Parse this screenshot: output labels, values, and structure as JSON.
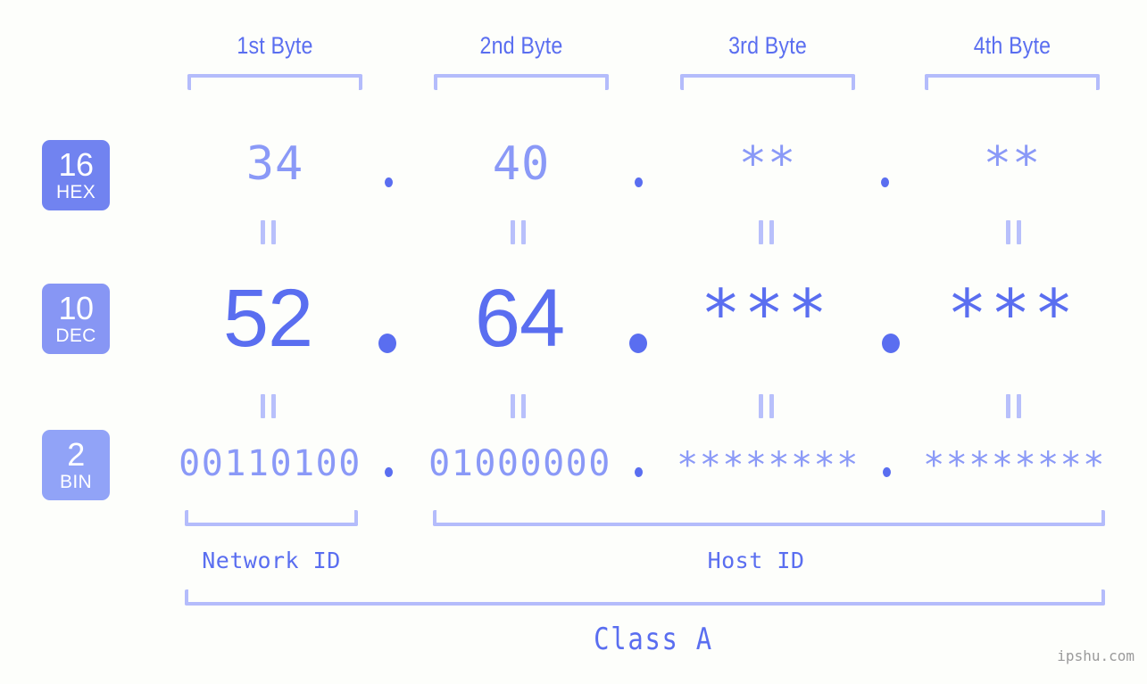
{
  "meta": {
    "background_color": "#fdfefb",
    "accent_strong": "#5a6ef0",
    "accent_light": "#8a99f7",
    "accent_pale": "#b4bcfb",
    "watermark": "ipshu.com"
  },
  "byte_headers": [
    {
      "label": "1st Byte"
    },
    {
      "label": "2nd Byte"
    },
    {
      "label": "3rd Byte"
    },
    {
      "label": "4th Byte"
    }
  ],
  "bases": [
    {
      "num": "16",
      "name": "HEX",
      "color": "#7183f0"
    },
    {
      "num": "10",
      "name": "DEC",
      "color": "#8796f4"
    },
    {
      "num": "2",
      "name": "BIN",
      "color": "#91a3f7"
    }
  ],
  "rows": {
    "hex": {
      "base": "16",
      "values": [
        "34",
        "40",
        "**",
        "**"
      ]
    },
    "dec": {
      "base": "10",
      "values": [
        "52",
        "64",
        "***",
        "***"
      ]
    },
    "bin": {
      "base": "2",
      "values": [
        "00110100",
        "01000000",
        "********",
        "********"
      ]
    }
  },
  "separators": {
    "dot": ".",
    "equals_glyph": "="
  },
  "sections": [
    {
      "label": "Network ID"
    },
    {
      "label": "Host ID"
    }
  ],
  "class": {
    "label": "Class A"
  }
}
